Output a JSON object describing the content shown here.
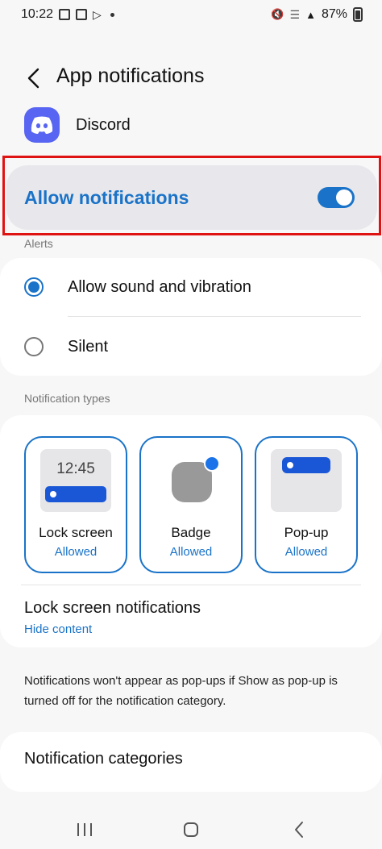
{
  "status_bar": {
    "time": "10:22",
    "battery": "87%"
  },
  "header": {
    "title": "App notifications"
  },
  "app": {
    "name": "Discord"
  },
  "allow_notifications": {
    "label": "Allow notifications",
    "enabled": true
  },
  "alerts": {
    "section_label": "Alerts",
    "options": [
      {
        "label": "Allow sound and vibration",
        "selected": true
      },
      {
        "label": "Silent",
        "selected": false
      }
    ]
  },
  "notification_types": {
    "section_label": "Notification types",
    "tiles": [
      {
        "name": "Lock screen",
        "status": "Allowed",
        "preview_time": "12:45"
      },
      {
        "name": "Badge",
        "status": "Allowed"
      },
      {
        "name": "Pop-up",
        "status": "Allowed"
      }
    ],
    "lock_screen_notifications": {
      "title": "Lock screen notifications",
      "value": "Hide content"
    }
  },
  "footnote": "Notifications won't appear as pop-ups if Show as pop-up is turned off for the notification category.",
  "categories": {
    "label": "Notification categories"
  },
  "colors": {
    "accent": "#1a73c8",
    "highlight": "#e01313",
    "discord": "#5865f2"
  }
}
